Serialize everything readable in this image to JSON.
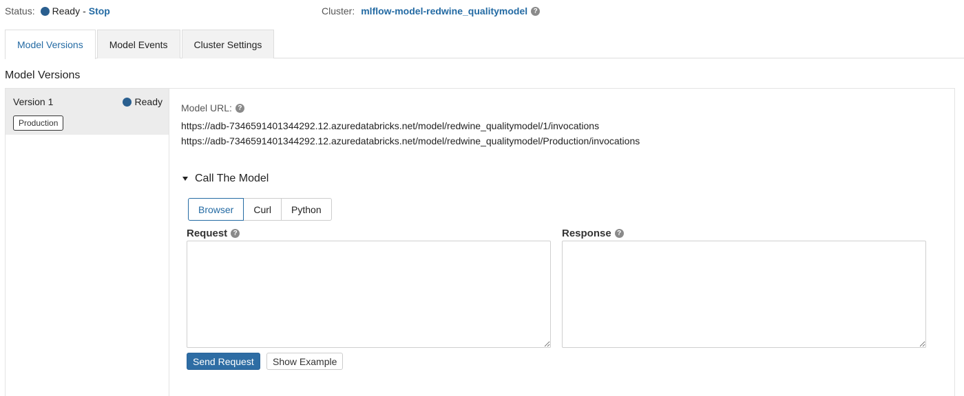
{
  "status": {
    "label": "Status:",
    "value": "Ready",
    "separator": "-",
    "stop_link": "Stop"
  },
  "cluster": {
    "label": "Cluster:",
    "name": "mlflow-model-redwine_qualitymodel",
    "help": "?"
  },
  "tabs": [
    {
      "label": "Model Versions",
      "active": true
    },
    {
      "label": "Model Events",
      "active": false
    },
    {
      "label": "Cluster Settings",
      "active": false
    }
  ],
  "section_title": "Model Versions",
  "versions": [
    {
      "label": "Version 1",
      "status": "Ready",
      "stage": "Production"
    }
  ],
  "detail": {
    "url_label": "Model URL:",
    "help": "?",
    "urls": [
      "https://adb-7346591401344292.12.azuredatabricks.net/model/redwine_qualitymodel/1/invocations",
      "https://adb-7346591401344292.12.azuredatabricks.net/model/redwine_qualitymodel/Production/invocations"
    ],
    "call_section": "Call The Model",
    "modes": [
      {
        "label": "Browser",
        "active": true
      },
      {
        "label": "Curl",
        "active": false
      },
      {
        "label": "Python",
        "active": false
      }
    ],
    "request_label": "Request",
    "response_label": "Response",
    "request_value": "",
    "response_value": "",
    "send_button": "Send Request",
    "example_button": "Show Example"
  },
  "colors": {
    "accent": "#236aa3",
    "status_dot": "#2a5f8f",
    "primary_button": "#2e6da4"
  }
}
